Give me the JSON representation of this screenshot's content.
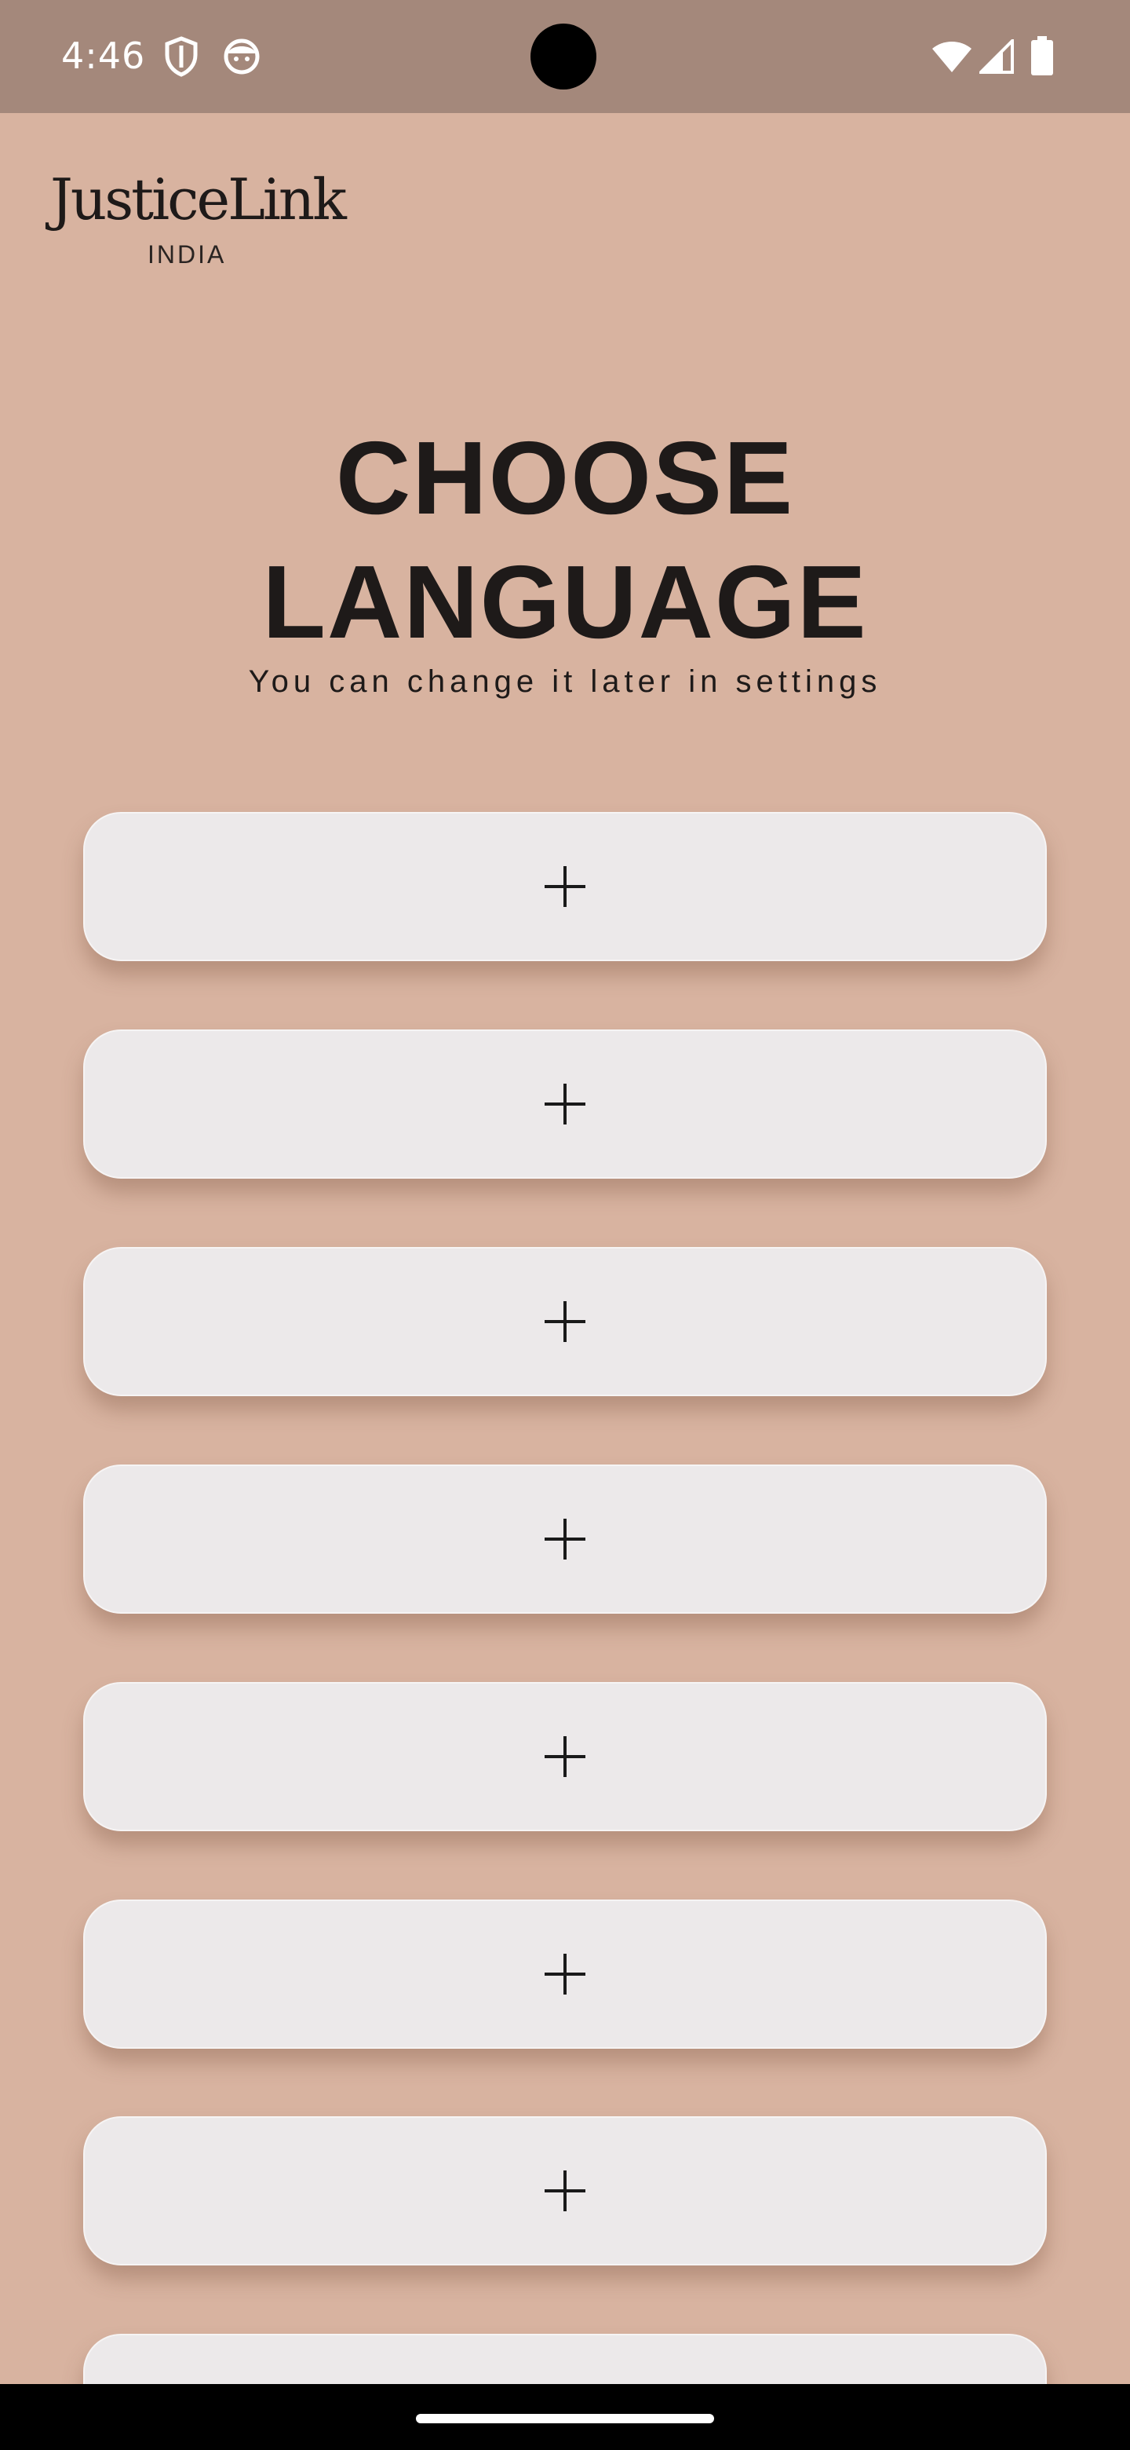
{
  "status_bar": {
    "time": "4:46",
    "icons_left": [
      "shield-icon",
      "face-icon"
    ],
    "icons_right": [
      "wifi-icon",
      "signal-icon",
      "battery-icon"
    ],
    "background": "#a4887b"
  },
  "logo": {
    "name": "JusticeLink",
    "tagline": "INDIA"
  },
  "heading": {
    "line1": "CHOOSE",
    "line2": "LANGUAGE",
    "subtitle": "You can change it later in settings"
  },
  "languages": {
    "button_icon": "plus-icon",
    "options": [
      "",
      "",
      "",
      "",
      "",
      "",
      "",
      ""
    ]
  },
  "colors": {
    "background": "#d8b3a0",
    "button": "#ece9ea",
    "text": "#1e1a19"
  }
}
